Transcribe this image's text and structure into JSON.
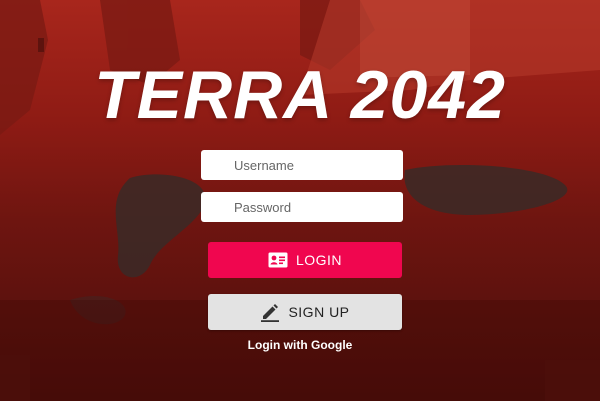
{
  "app": {
    "title": "TERRA 2042"
  },
  "form": {
    "username_placeholder": "Username",
    "password_placeholder": "Password",
    "username_value": "",
    "password_value": ""
  },
  "buttons": {
    "login_label": "LOGIN",
    "login_icon": "id-card-icon",
    "signup_label": "SIGN UP",
    "signup_icon": "pencil-icon",
    "google_label": "Login with Google"
  },
  "colors": {
    "background": "#8e1b14",
    "login_button": "#f0064f",
    "signup_button": "#e3e3e3",
    "title_text": "#ffffff"
  }
}
